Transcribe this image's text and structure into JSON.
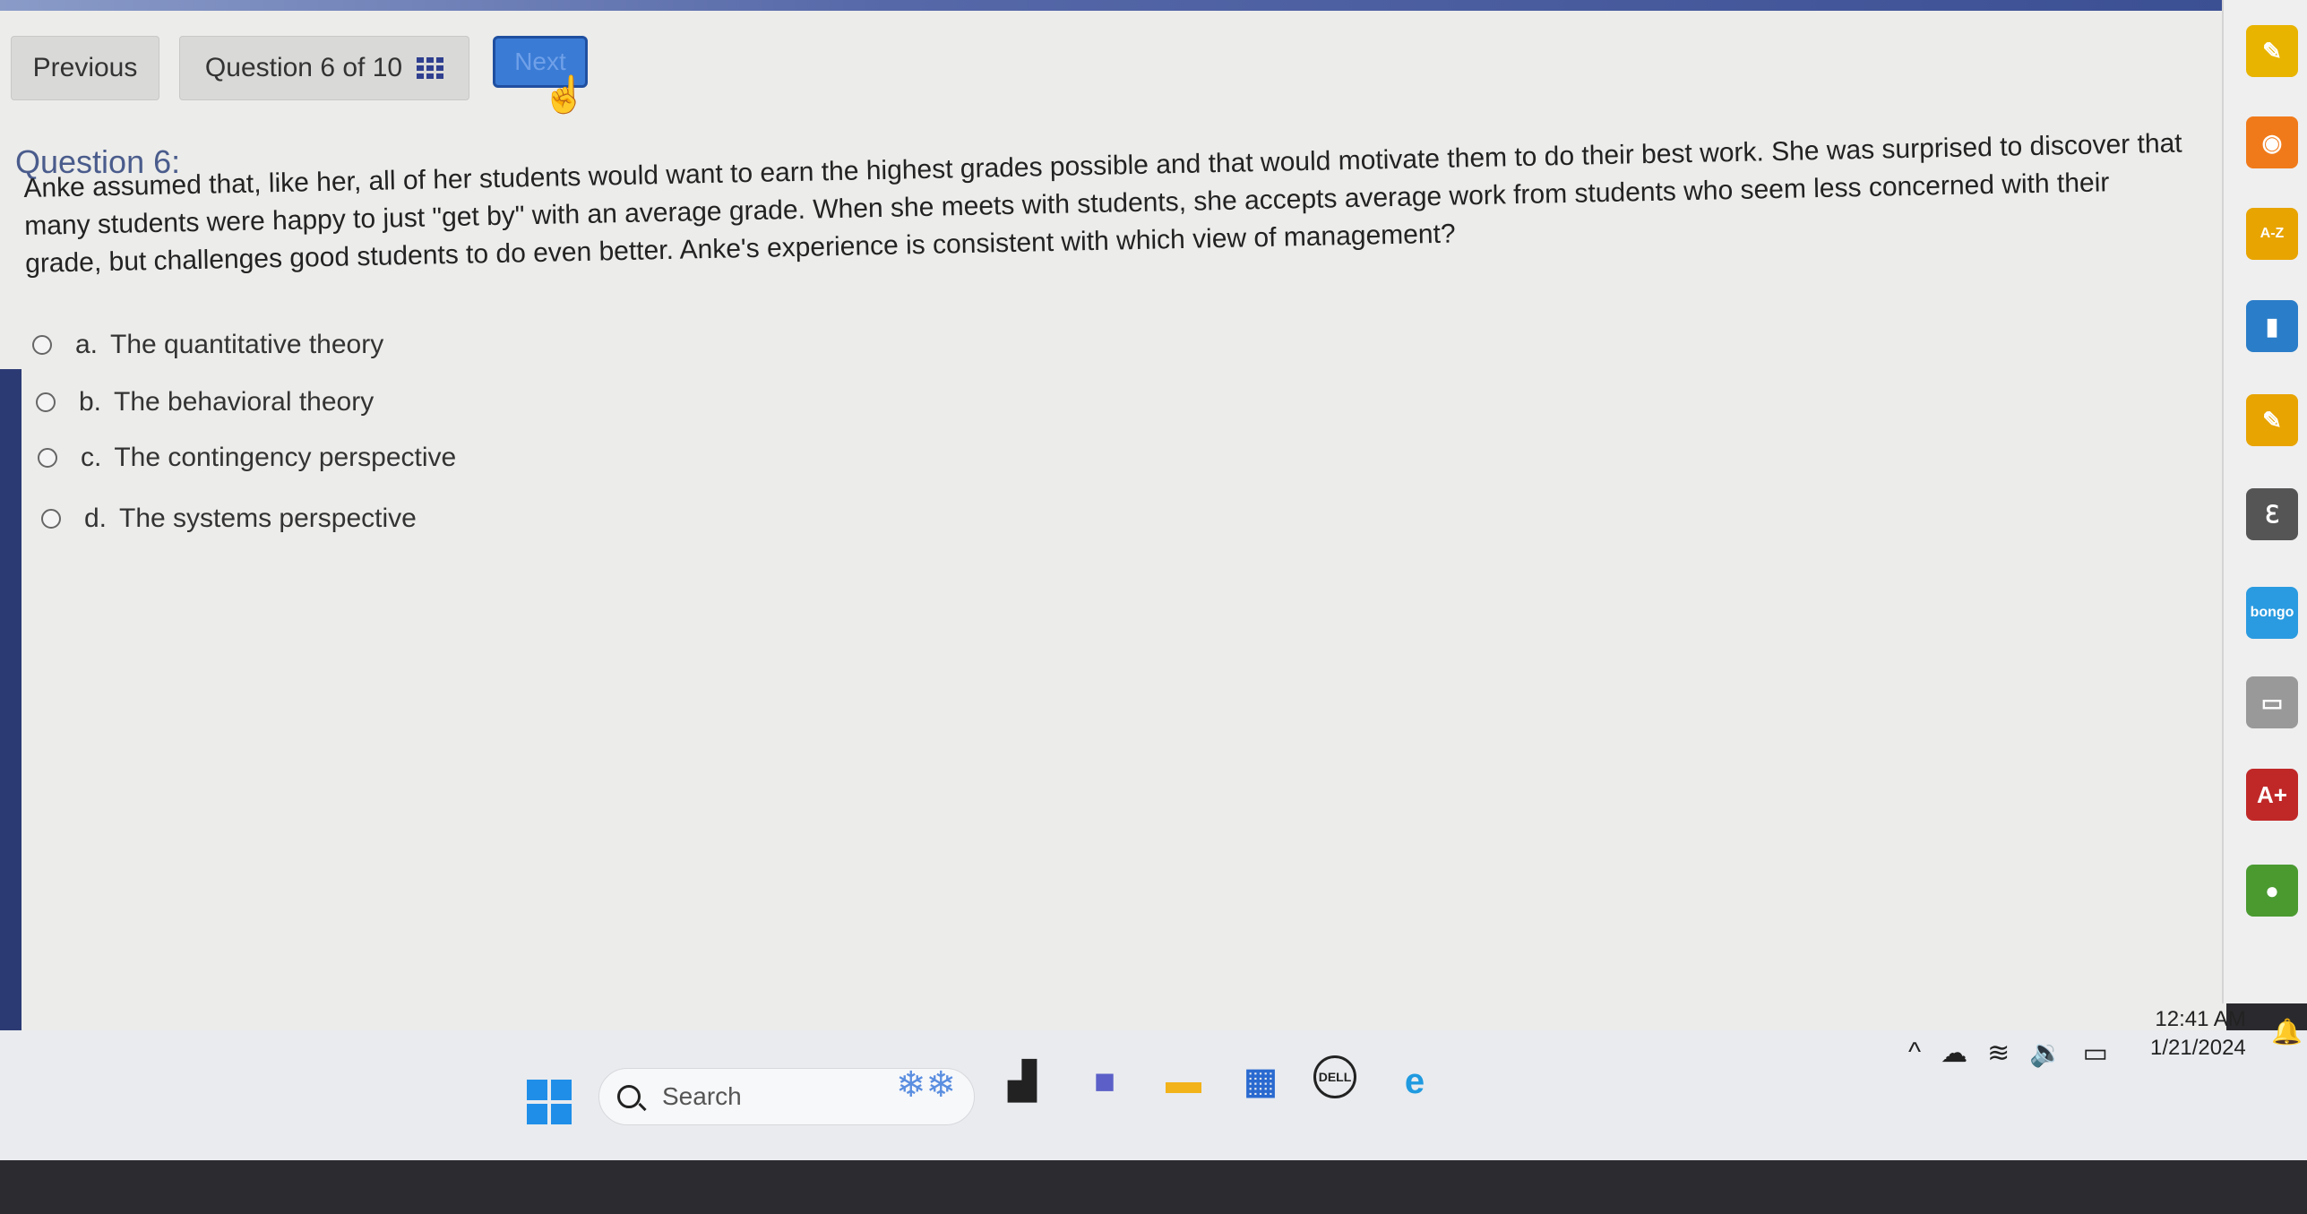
{
  "nav": {
    "previous_label": "Previous",
    "counter_label": "Question 6 of 10",
    "next_label": "Next"
  },
  "question": {
    "title": "Question 6:",
    "text": "Anke assumed that, like her, all of her students would want to earn the highest grades possible and that would motivate them to do their best work. She was surprised to discover that many students were happy to just \"get by\" with an average grade. When she meets with students, she accepts average work from students who seem less concerned with their grade, but challenges good students to do even better. Anke's experience is consistent with which view of management?",
    "options": [
      {
        "letter": "a.",
        "label": "The quantitative theory"
      },
      {
        "letter": "b.",
        "label": "The behavioral theory"
      },
      {
        "letter": "c.",
        "label": "The contingency perspective"
      },
      {
        "letter": "d.",
        "label": "The systems perspective"
      }
    ]
  },
  "sidebar": {
    "icons": [
      {
        "name": "pencil-icon",
        "text": "✎",
        "color": "#e8b400"
      },
      {
        "name": "rss-icon",
        "text": "◉",
        "color": "#f07a1a"
      },
      {
        "name": "a-z-icon",
        "text": "A-Z",
        "color": "#e8a400"
      },
      {
        "name": "book-icon",
        "text": "▮",
        "color": "#2a7dc8"
      },
      {
        "name": "notes-icon",
        "text": "✎",
        "color": "#e8a400"
      },
      {
        "name": "text-to-speech-icon",
        "text": "ℇ",
        "color": "#555555"
      },
      {
        "name": "bongo-icon",
        "text": "bongo",
        "color": "#2a9be0"
      },
      {
        "name": "flashcard-icon",
        "text": "▭",
        "color": "#999999"
      },
      {
        "name": "grade-icon",
        "text": "A+",
        "color": "#c02828"
      },
      {
        "name": "profile-icon",
        "text": "●",
        "color": "#4a9a30"
      }
    ]
  },
  "taskbar": {
    "search_placeholder": "Search",
    "time": "12:41 AM",
    "date": "1/21/2024",
    "apps": [
      {
        "name": "task-view-icon",
        "text": "▟",
        "color": "#222222"
      },
      {
        "name": "teams-meet-icon",
        "text": "■",
        "color": "#5b5fc7"
      },
      {
        "name": "file-explorer-icon",
        "text": "▬",
        "color": "#f2b21a"
      },
      {
        "name": "store-icon",
        "text": "▦",
        "color": "#2a6ad0"
      },
      {
        "name": "dell-icon",
        "text": "DELL",
        "color": "#222222"
      },
      {
        "name": "edge-icon",
        "text": "e",
        "color": "#1f9ae0"
      }
    ]
  }
}
